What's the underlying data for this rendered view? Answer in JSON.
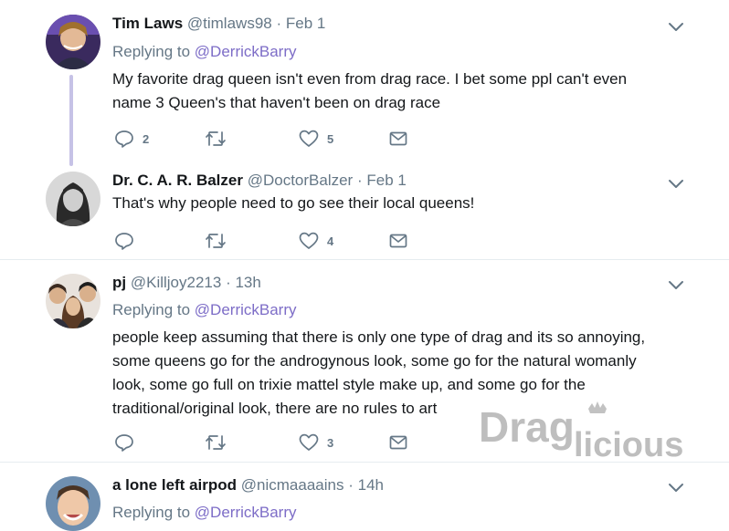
{
  "tweets": [
    {
      "name": "Tim Laws",
      "handle": "@timlaws98",
      "dot": "·",
      "time": "Feb 1",
      "replying_prefix": "Replying to",
      "replying_to": "@DerrickBarry",
      "lines": [
        "My favorite drag queen isn't even from drag race. I bet some ppl can't even",
        "name 3 Queen's that haven't been on drag race"
      ],
      "reply_count": "2",
      "retweet_count": "",
      "like_count": "5"
    },
    {
      "name": "Dr. C. A. R. Balzer",
      "handle": "@DoctorBalzer",
      "dot": "·",
      "time": "Feb 1",
      "lines": [
        "That's why people need to go see their local queens!"
      ],
      "reply_count": "",
      "retweet_count": "",
      "like_count": "4"
    },
    {
      "name": "pj",
      "handle": "@Killjoy2213",
      "dot": "·",
      "time": "13h",
      "replying_prefix": "Replying to",
      "replying_to": "@DerrickBarry",
      "lines": [
        "people keep assuming that there is only one type of drag and its so annoying,",
        "some queens go for the androgynous look, some go for the natural womanly",
        "look, some go full on trixie mattel style make up, and some go for the",
        "traditional/original look, there are no rules to art"
      ],
      "reply_count": "",
      "retweet_count": "",
      "like_count": "3"
    },
    {
      "name": "a lone left airpod",
      "handle": "@nicmaaaains",
      "dot": "·",
      "time": "14h",
      "replying_prefix": "Replying to",
      "replying_to": "@DerrickBarry"
    }
  ],
  "watermark": {
    "part1": "Drag",
    "part2": "licious"
  },
  "icons": {
    "reply": "reply-icon",
    "retweet": "retweet-icon",
    "like": "heart-icon",
    "dm": "envelope-icon",
    "more": "chevron-down-icon"
  },
  "colors": {
    "link": "#7d6dc7",
    "muted": "#657786",
    "thread_line": "#c6c2e6"
  }
}
